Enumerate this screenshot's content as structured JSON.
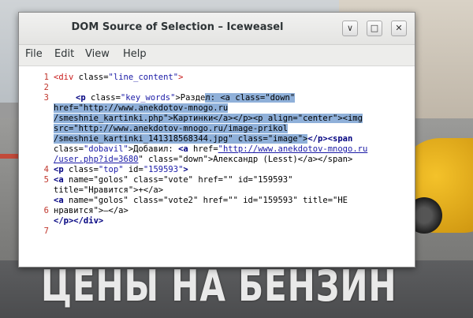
{
  "window": {
    "title": "DOM Source of Selection – Iceweasel",
    "controls": {
      "minimize": "∨",
      "maximize": "□",
      "close": "✕"
    }
  },
  "menu": {
    "file": "File",
    "edit": "Edit",
    "view": "View",
    "help": "Help"
  },
  "background": {
    "caption": "ЦЕНЫ НА БЕНЗИН"
  },
  "source": {
    "line_numbers": [
      "1",
      "2",
      "3",
      "4",
      "5",
      "6",
      "7"
    ],
    "l1": {
      "open": "<div ",
      "attr": "class=",
      "val": "\"line_content\"",
      "close": ">"
    },
    "l3a": {
      "tag": "<p ",
      "attr": "class=",
      "val": "\"key_words\"",
      "text": ">Разде",
      "sel": "л: <a class=\"down\""
    },
    "l3b": {
      "sel1": "href=\"http://www.anekdotov-mnogo.ru"
    },
    "l3c": {
      "sel1": "/smeshnie_kartinki.php\">Картинки</a></p><p align=\"center\"><img"
    },
    "l3d": {
      "sel1": "src=\"http://www.anekdotov-mnogo.ru/image-prikol"
    },
    "l3e": {
      "sel1": "/smeshnie_kartinki_141318568344.jpg\" class=\"image\">",
      "after": "</p><span"
    },
    "l3f": {
      "attr": "class=",
      "val": "\"dobavil\"",
      "text": ">Добавил: ",
      "a": "<a ",
      "href_attr": "href=",
      "href": "\"http://www.anekdotov-mnogo.ru"
    },
    "l3g": {
      "href2": "/user.php?id=3680",
      "rest": "\" class=\"down\">Александр (Lesst)</a></span>"
    },
    "l4": {
      "tag": "<p ",
      "attr": "class=",
      "val": "\"top\"",
      "id_attr": " id=",
      "id_val": "\"159593\"",
      "close": ">"
    },
    "l5a": {
      "tag": "<a ",
      "text": "name=\"golos\" class=\"vote\" href=\"\" id=\"159593\""
    },
    "l5b": {
      "text": "title=\"Нравится\">+</a>"
    },
    "l6a": {
      "tag": "<a ",
      "text": "name=\"golos\" class=\"vote2\" href=\"\" id=\"159593\" title=\"НЕ"
    },
    "l6b": {
      "text": "нравится\">–</a>"
    },
    "l7": {
      "text": "</p></div>"
    }
  }
}
